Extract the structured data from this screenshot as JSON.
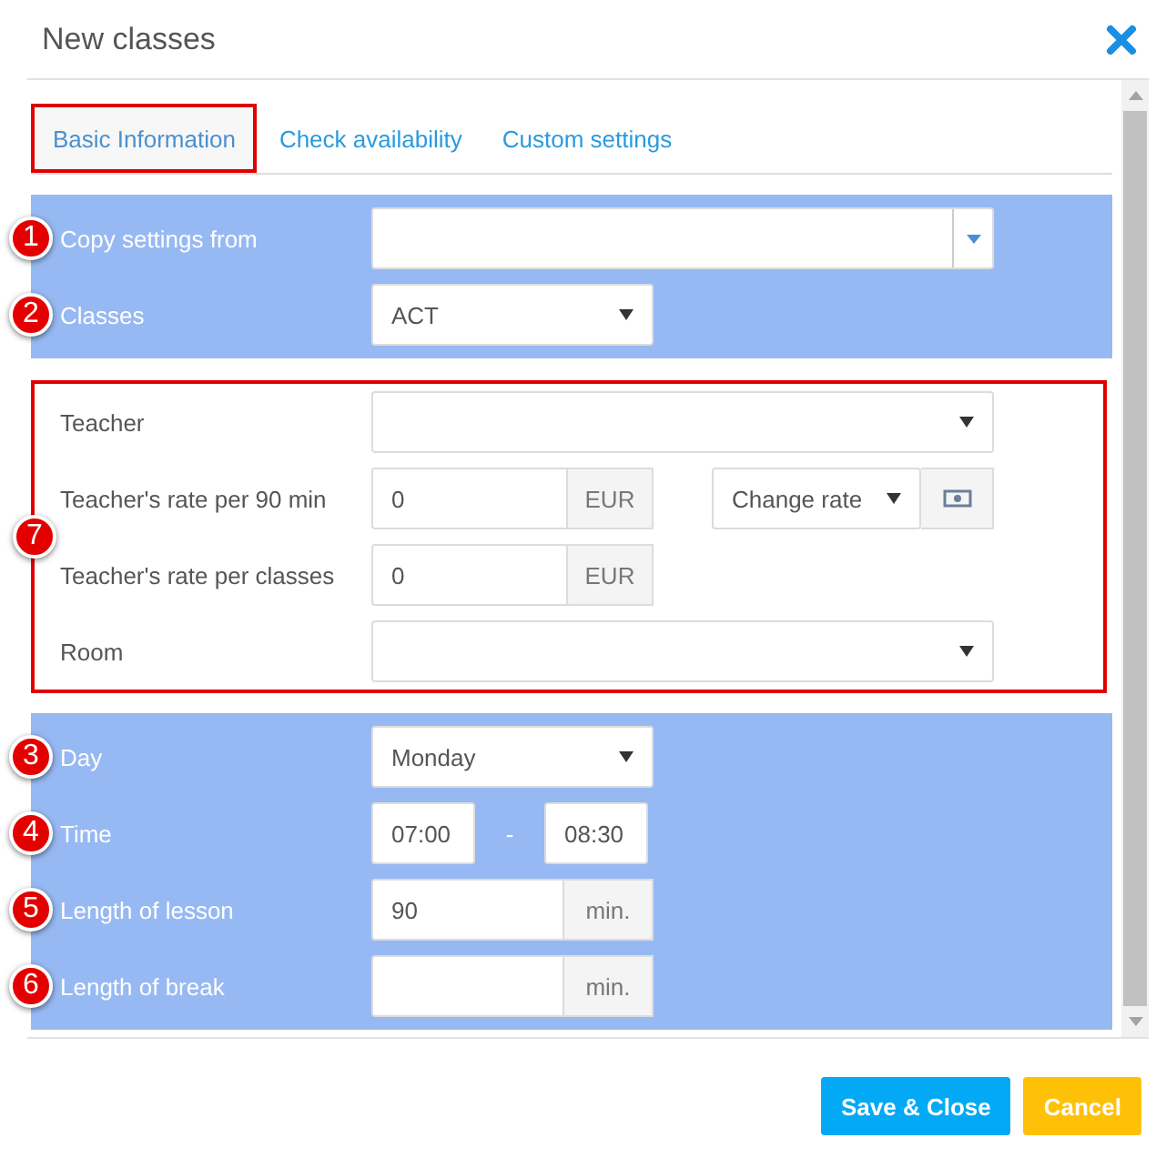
{
  "window": {
    "title": "New classes"
  },
  "tabs": [
    {
      "label": "Basic Information",
      "selected": true
    },
    {
      "label": "Check availability",
      "selected": false
    },
    {
      "label": "Custom settings",
      "selected": false
    }
  ],
  "sections": [
    {
      "kind": "shaded",
      "rows": [
        {
          "badge": "1",
          "label": "Copy settings from",
          "kind": "combo"
        },
        {
          "badge": "2",
          "label": "Classes",
          "kind": "select",
          "value": "ACT"
        }
      ]
    },
    {
      "kind": "outlined",
      "badge": "7",
      "rows": [
        {
          "label": "Teacher",
          "kind": "wide-select"
        },
        {
          "label": "Teacher's rate per 90 min",
          "kind": "rate",
          "value": "0",
          "unit": "EUR",
          "option": "Change rate"
        },
        {
          "label": "Teacher's rate per classes",
          "kind": "unit",
          "value": "0",
          "unit": "EUR"
        },
        {
          "label": "Room",
          "kind": "wide-select"
        }
      ]
    },
    {
      "kind": "shaded",
      "rows": [
        {
          "badge": "3",
          "label": "Day",
          "kind": "select",
          "value": "Monday"
        },
        {
          "badge": "4",
          "label": "Time",
          "kind": "range",
          "from": "07:00",
          "separator": "-",
          "to": "08:30"
        },
        {
          "badge": "5",
          "label": "Length of lesson",
          "kind": "unit",
          "value": "90",
          "unit": "min."
        },
        {
          "badge": "6",
          "label": "Length of break",
          "kind": "unit",
          "unit": "min."
        }
      ]
    }
  ],
  "buttons": [
    {
      "label": "Save & Close",
      "kind": "primary"
    },
    {
      "label": "Cancel",
      "kind": "warning"
    }
  ]
}
